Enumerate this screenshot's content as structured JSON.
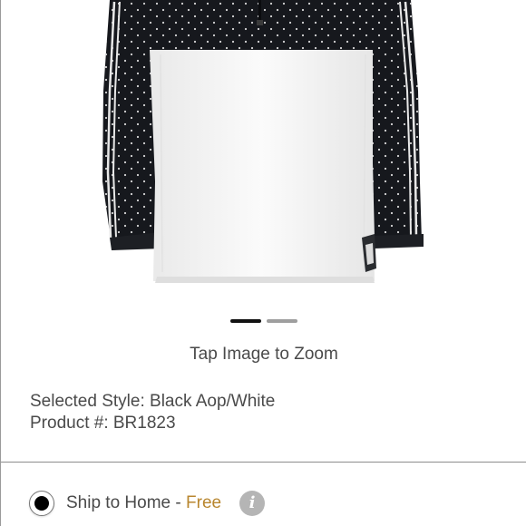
{
  "product_image": {
    "icon": "windbreaker-jacket-photo",
    "colors": {
      "dark_panel": "#16181d",
      "light_panel": "#f7f7f7"
    }
  },
  "carousel": {
    "total": 2,
    "active_index": 1
  },
  "zoom_hint": "Tap Image to Zoom",
  "style_info": {
    "selected_style": "Selected Style: Black Aop/White",
    "product_number": "Product #: BR1823"
  },
  "shipping": {
    "option_label": "Ship to Home",
    "separator": " - ",
    "price": "Free",
    "selected": true,
    "info_icon_glyph": "i",
    "colors": {
      "price": "#b8862f",
      "radio": "#000000",
      "info_icon": "#b5b5b5"
    }
  }
}
